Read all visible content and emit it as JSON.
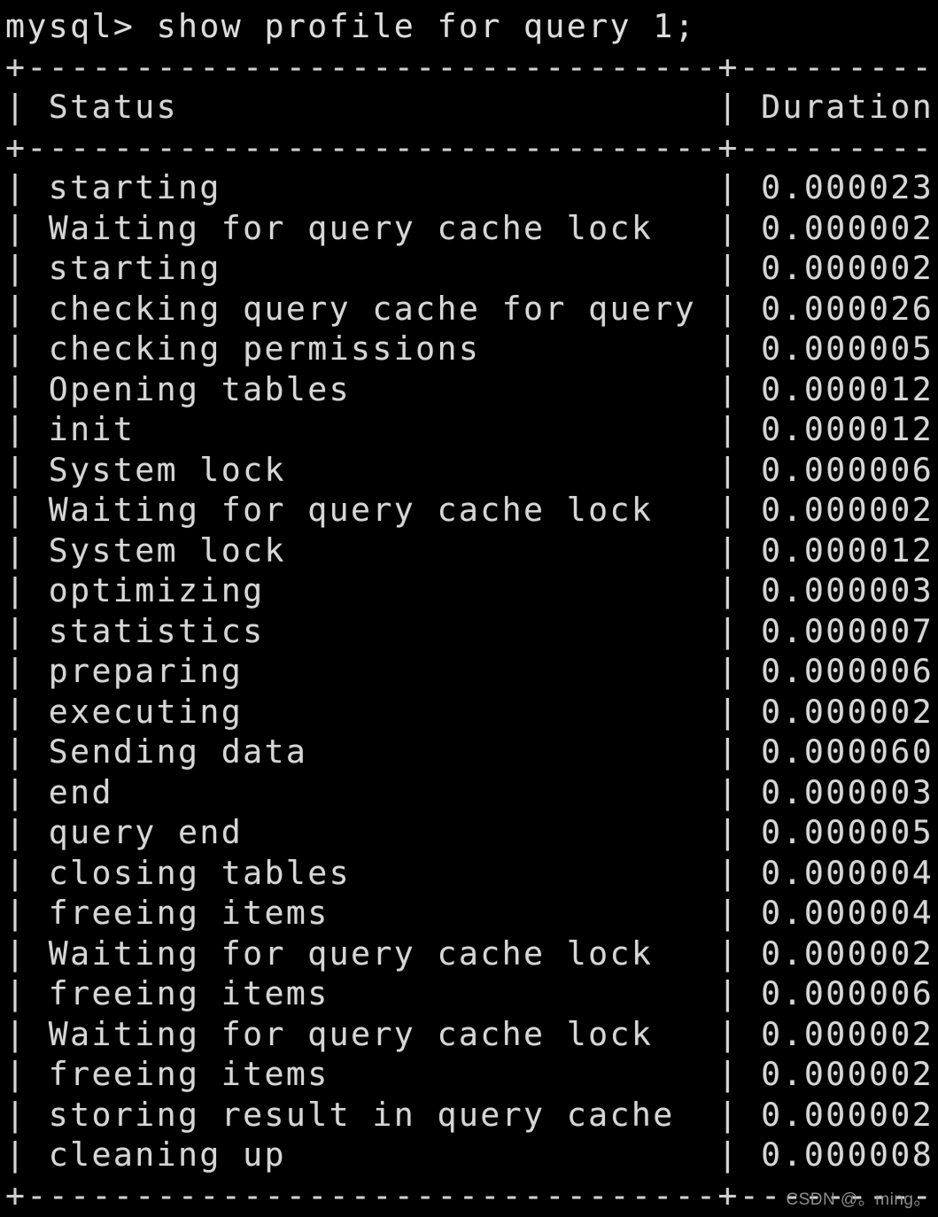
{
  "terminal": {
    "prompt_line": "mysql> show profile for query 1;",
    "prompt_symbol": "mysql>",
    "command": "show profile for query 1;",
    "background_color": "#000000",
    "text_color": "#d6d6d6"
  },
  "table": {
    "status_column_width": 30,
    "duration_column_width": 8,
    "separator_line": "+--------------------------------+----------+",
    "headers": [
      "Status",
      "Duration"
    ],
    "header_line": "| Status                         | Duration |",
    "row_count": 25,
    "rows": [
      {
        "status": "starting",
        "duration": "0.000023"
      },
      {
        "status": "Waiting for query cache lock",
        "duration": "0.000002"
      },
      {
        "status": "starting",
        "duration": "0.000002"
      },
      {
        "status": "checking query cache for query",
        "duration": "0.000026"
      },
      {
        "status": "checking permissions",
        "duration": "0.000005"
      },
      {
        "status": "Opening tables",
        "duration": "0.000012"
      },
      {
        "status": "init",
        "duration": "0.000012"
      },
      {
        "status": "System lock",
        "duration": "0.000006"
      },
      {
        "status": "Waiting for query cache lock",
        "duration": "0.000002"
      },
      {
        "status": "System lock",
        "duration": "0.000012"
      },
      {
        "status": "optimizing",
        "duration": "0.000003"
      },
      {
        "status": "statistics",
        "duration": "0.000007"
      },
      {
        "status": "preparing",
        "duration": "0.000006"
      },
      {
        "status": "executing",
        "duration": "0.000002"
      },
      {
        "status": "Sending data",
        "duration": "0.000060"
      },
      {
        "status": "end",
        "duration": "0.000003"
      },
      {
        "status": "query end",
        "duration": "0.000005"
      },
      {
        "status": "closing tables",
        "duration": "0.000004"
      },
      {
        "status": "freeing items",
        "duration": "0.000004"
      },
      {
        "status": "Waiting for query cache lock",
        "duration": "0.000002"
      },
      {
        "status": "freeing items",
        "duration": "0.000006"
      },
      {
        "status": "Waiting for query cache lock",
        "duration": "0.000002"
      },
      {
        "status": "freeing items",
        "duration": "0.000002"
      },
      {
        "status": "storing result in query cache",
        "duration": "0.000002"
      },
      {
        "status": "cleaning up",
        "duration": "0.000008"
      }
    ]
  },
  "watermark": {
    "text": "CSDN @。ming。"
  }
}
